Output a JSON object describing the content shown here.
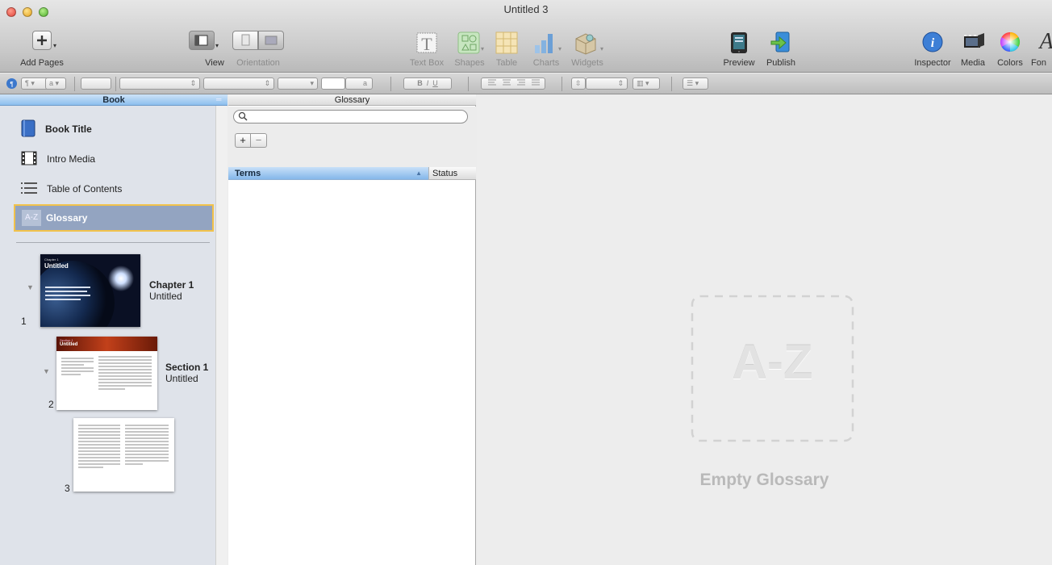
{
  "window": {
    "title": "Untitled 3"
  },
  "toolbar": {
    "add_pages": "Add Pages",
    "view": "View",
    "orientation": "Orientation",
    "text_box": "Text Box",
    "shapes": "Shapes",
    "table": "Table",
    "charts": "Charts",
    "widgets": "Widgets",
    "preview": "Preview",
    "publish": "Publish",
    "inspector": "Inspector",
    "media": "Media",
    "colors": "Colors",
    "fonts": "Fon"
  },
  "formatbar": {
    "style_a": "a",
    "size_a": "a",
    "bold": "B",
    "italic": "I",
    "underline": "U"
  },
  "sidebar": {
    "header": "Book",
    "items": [
      {
        "label": "Book Title",
        "icon": "book-icon"
      },
      {
        "label": "Intro Media",
        "icon": "film-icon"
      },
      {
        "label": "Table of Contents",
        "icon": "list-icon"
      },
      {
        "label": "Glossary",
        "icon": "az-icon",
        "icon_text": "A-Z",
        "selected": true
      }
    ],
    "pages": [
      {
        "number": "1",
        "title": "Chapter 1",
        "subtitle": "Untitled",
        "thumb_label": "Untitled",
        "thumb_kicker": "Chapter 1"
      },
      {
        "number": "2",
        "title": "Section 1",
        "subtitle": "Untitled",
        "thumb_label": "Untitled",
        "thumb_kicker": "Section 1"
      },
      {
        "number": "3",
        "title": "",
        "subtitle": ""
      }
    ]
  },
  "glossary": {
    "header": "Glossary",
    "search_placeholder": "",
    "add": "+",
    "remove": "−",
    "columns": {
      "terms": "Terms",
      "status": "Status"
    },
    "sort_indicator": "▲"
  },
  "canvas": {
    "az_text": "A-Z",
    "empty_label": "Empty Glossary"
  },
  "colors": {
    "selection_border": "#f1c24b",
    "selection_fill": "#93a4c1",
    "header_blue": "#8dbfee"
  }
}
